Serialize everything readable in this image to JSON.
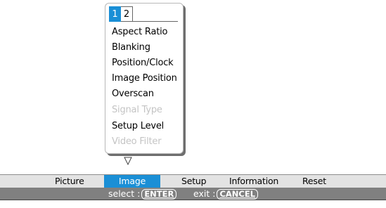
{
  "menu": {
    "tabs": [
      {
        "label": "1",
        "active": true
      },
      {
        "label": "2",
        "active": false
      }
    ],
    "items": [
      {
        "label": "Aspect Ratio",
        "enabled": true
      },
      {
        "label": "Blanking",
        "enabled": true
      },
      {
        "label": "Position/Clock",
        "enabled": true
      },
      {
        "label": "Image Position",
        "enabled": true
      },
      {
        "label": "Overscan",
        "enabled": true
      },
      {
        "label": "Signal Type",
        "enabled": false
      },
      {
        "label": "Setup Level",
        "enabled": true
      },
      {
        "label": "Video Filter",
        "enabled": false
      }
    ],
    "more_indicator_icon": "down-triangle-icon"
  },
  "menu_bar": {
    "items": [
      {
        "label": "Picture",
        "selected": false
      },
      {
        "label": "Image",
        "selected": true
      },
      {
        "label": "Setup",
        "selected": false
      },
      {
        "label": "Information",
        "selected": false
      },
      {
        "label": "Reset",
        "selected": false
      }
    ]
  },
  "hints": {
    "select_label": "select :",
    "select_key": "ENTER",
    "exit_label": "exit :",
    "exit_key": "CANCEL"
  },
  "colors": {
    "accent": "#1a8fd6",
    "disabled_text": "#c4c4c4",
    "hint_bar_bg": "#808080",
    "menu_bar_bg": "#e3e3e3"
  }
}
